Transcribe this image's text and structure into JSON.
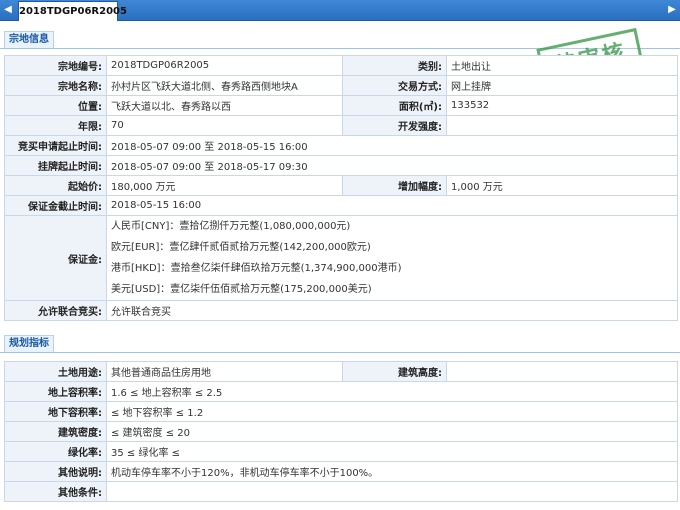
{
  "tab": {
    "title": "2018TDGP06R2005"
  },
  "sections": {
    "parcel_info": "宗地信息",
    "planning": "规划指标"
  },
  "stamp": "待审核",
  "parcel": {
    "code_label": "宗地编号:",
    "code": "2018TDGP06R2005",
    "category_label": "类别:",
    "category": "土地出让",
    "name_label": "宗地名称:",
    "name": "孙村片区飞跃大道北侧、春秀路西侧地块A",
    "method_label": "交易方式:",
    "method": "网上挂牌",
    "location_label": "位置:",
    "location": "飞跃大道以北、春秀路以西",
    "area_label": "面积(㎡):",
    "area": "133532",
    "term_label": "年限:",
    "term": "70",
    "intensity_label": "开发强度:",
    "intensity": "",
    "bid_period_label": "竞买申请起止时间:",
    "bid_period": "2018-05-07 09:00 至 2018-05-15 16:00",
    "listing_period_label": "挂牌起止时间:",
    "listing_period": "2018-05-07 09:00 至 2018-05-17 09:30",
    "start_price_label": "起始价:",
    "start_price": "180,000 万元",
    "increment_label": "增加幅度:",
    "increment": "1,000 万元",
    "deposit_deadline_label": "保证金截止时间:",
    "deposit_deadline": "2018-05-15 16:00",
    "deposit_label": "保证金:",
    "deposit_lines": [
      "人民币[CNY]：壹拾亿捌仟万元整(1,080,000,000元)",
      "欧元[EUR]：壹亿肆仟贰佰贰拾万元整(142,200,000欧元)",
      "港币[HKD]：壹拾叁亿柒仟肆佰玖拾万元整(1,374,900,000港币)",
      "美元[USD]：壹亿柒仟伍佰贰拾万元整(175,200,000美元)"
    ],
    "joint_bid_label": "允许联合竞买:",
    "joint_bid": "允许联合竞买"
  },
  "planning": {
    "use_label": "土地用途:",
    "use": "其他普通商品住房用地",
    "height_label": "建筑高度:",
    "height": "",
    "far_above_label": "地上容积率:",
    "far_above": "1.6 ≤ 地上容积率 ≤ 2.5",
    "far_below_label": "地下容积率:",
    "far_below": "≤ 地下容积率 ≤ 1.2",
    "density_label": "建筑密度:",
    "density": "≤ 建筑密度 ≤ 20",
    "green_label": "绿化率:",
    "green": "35 ≤ 绿化率 ≤",
    "other_desc_label": "其他说明:",
    "other_desc": "机动车停车率不小于120%，非机动车停车率不小于100%。",
    "other_cond_label": "其他条件:",
    "other_cond": ""
  }
}
